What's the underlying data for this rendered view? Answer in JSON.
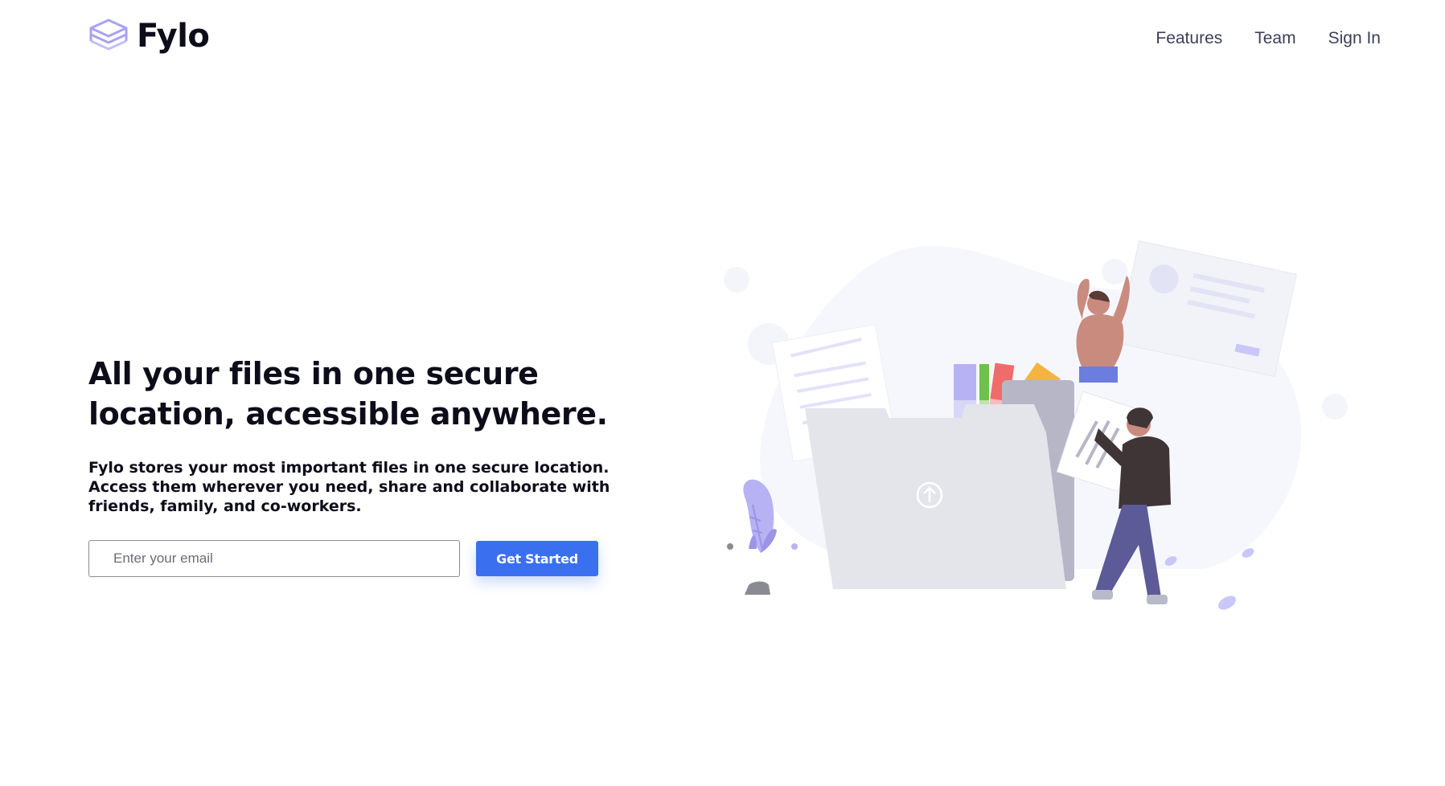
{
  "brand": {
    "name": "Fylo",
    "logo_icon": "stacked-layers-icon",
    "accent_color": "#3a6ff0",
    "logo_color": "#a7a2f2"
  },
  "nav": {
    "items": [
      {
        "label": "Features"
      },
      {
        "label": "Team"
      },
      {
        "label": "Sign In"
      }
    ]
  },
  "hero": {
    "title": "All your files in one secure location, accessible anywhere.",
    "description": "Fylo stores your most important files in one secure location. Access them wherever you need, share and collaborate with friends, family, and co-workers.",
    "email_placeholder": "Enter your email",
    "cta_label": "Get Started"
  },
  "illustration": {
    "icon": "upload-arrow-icon",
    "palette": {
      "blob": "#f6f7fc",
      "folder": "#e4e5ea",
      "folder_back": "#b6b6c6",
      "purple": "#b7b2f4",
      "swatch_green": "#6cc24a",
      "swatch_red": "#f26b6b",
      "swatch_orange": "#f5b342",
      "skin": "#c98b7e",
      "jacket": "#3f3537",
      "jeans": "#5c5b97"
    }
  }
}
